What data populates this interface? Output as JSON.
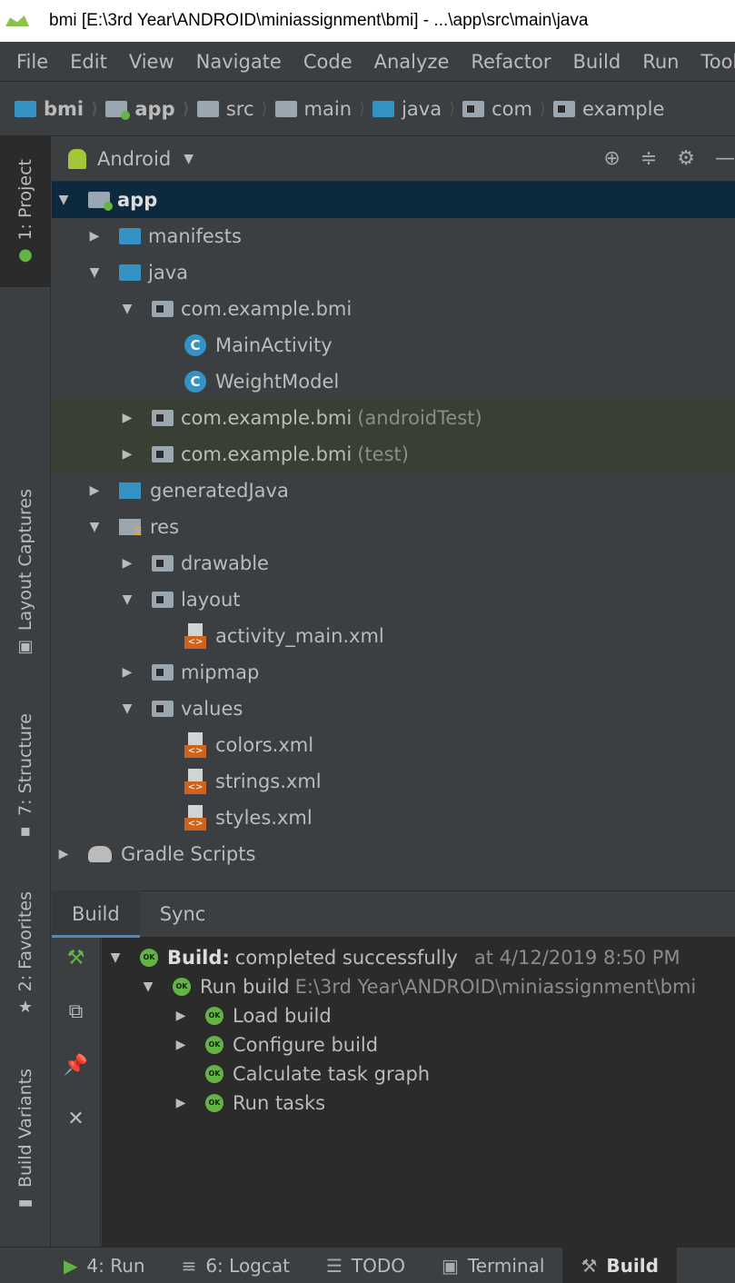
{
  "window": {
    "title": "bmi [E:\\3rd Year\\ANDROID\\miniassignment\\bmi] - ...\\app\\src\\main\\java"
  },
  "menu": {
    "items": [
      "File",
      "Edit",
      "View",
      "Navigate",
      "Code",
      "Analyze",
      "Refactor",
      "Build",
      "Run",
      "Tools"
    ]
  },
  "breadcrumb": {
    "items": [
      "bmi",
      "app",
      "src",
      "main",
      "java",
      "com",
      "example"
    ]
  },
  "left_stripe": {
    "project": "1: Project",
    "layout_captures": "Layout Captures",
    "structure": "7: Structure",
    "favorites": "2: Favorites",
    "build_variants": "Build Variants"
  },
  "project_panel": {
    "view_mode": "Android"
  },
  "tree": {
    "app": "app",
    "manifests": "manifests",
    "java": "java",
    "pkg_main": "com.example.bmi",
    "main_activity": "MainActivity",
    "weight_model": "WeightModel",
    "pkg_android_test": "com.example.bmi",
    "pkg_android_test_suffix": "(androidTest)",
    "pkg_test": "com.example.bmi",
    "pkg_test_suffix": "(test)",
    "generated_java": "generatedJava",
    "res": "res",
    "drawable": "drawable",
    "layout": "layout",
    "activity_main": "activity_main.xml",
    "mipmap": "mipmap",
    "values": "values",
    "colors": "colors.xml",
    "strings": "strings.xml",
    "styles": "styles.xml",
    "gradle_scripts": "Gradle Scripts"
  },
  "build_panel": {
    "tabs": [
      "Build",
      "Sync"
    ],
    "root_label": "Build:",
    "root_status": "completed successfully",
    "root_time": "at 4/12/2019 8:50 PM",
    "run_build": "Run build",
    "run_build_path": "E:\\3rd Year\\ANDROID\\miniassignment\\bmi",
    "load_build": "Load build",
    "configure_build": "Configure build",
    "calculate_task_graph": "Calculate task graph",
    "run_tasks": "Run tasks",
    "ok_badge": "OK"
  },
  "bottom_bar": {
    "items": [
      "4: Run",
      "6: Logcat",
      "TODO",
      "Terminal",
      "Build"
    ]
  }
}
